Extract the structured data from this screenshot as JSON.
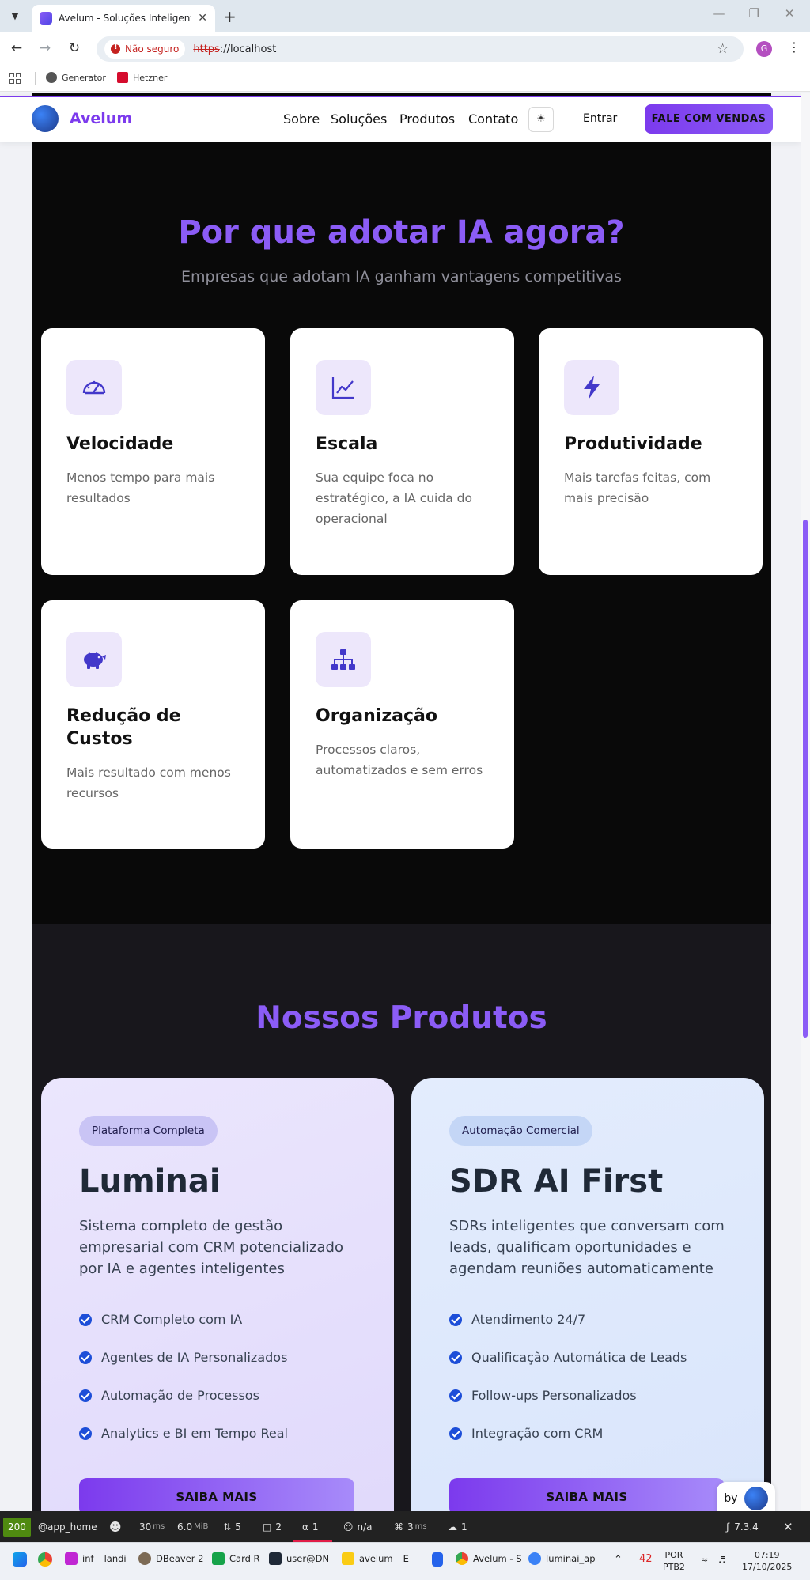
{
  "browser": {
    "tab_title": "Avelum - Soluções Inteligentes",
    "security_label": "Não seguro",
    "url_scheme": "https",
    "url_rest": "://localhost",
    "profile_initial": "G",
    "bookmarks": [
      "Generator",
      "Hetzner"
    ]
  },
  "header": {
    "logo_text": "Avelum",
    "logo_mark": "avelum",
    "nav": [
      "Sobre",
      "Soluções",
      "Produtos",
      "Contato"
    ],
    "login": "Entrar",
    "cta": "FALE COM VENDAS"
  },
  "why": {
    "title": "Por que adotar IA agora?",
    "subtitle": "Empresas que adotam IA ganham vantagens competitivas",
    "cards": [
      {
        "icon": "speedometer-icon",
        "title": "Velocidade",
        "desc": "Menos tempo para mais resultados"
      },
      {
        "icon": "chart-line-icon",
        "title": "Escala",
        "desc": "Sua equipe foca no estratégico, a IA cuida do operacional"
      },
      {
        "icon": "lightning-icon",
        "title": "Produtividade",
        "desc": "Mais tarefas feitas, com mais precisão"
      },
      {
        "icon": "piggy-bank-icon",
        "title": "Redução de Custos",
        "desc": "Mais resultado com menos recursos"
      },
      {
        "icon": "org-chart-icon",
        "title": "Organização",
        "desc": "Processos claros, automatizados e sem erros"
      }
    ]
  },
  "products": {
    "title": "Nossos Produtos",
    "items": [
      {
        "badge": "Plataforma Completa",
        "title": "Luminai",
        "desc": "Sistema completo de gestão empresarial com CRM potencializado por IA e agentes inteligentes",
        "features": [
          "CRM Completo com IA",
          "Agentes de IA Personalizados",
          "Automação de Processos",
          "Analytics e BI em Tempo Real"
        ],
        "button": "SAIBA MAIS"
      },
      {
        "badge": "Automação Comercial",
        "title": "SDR AI First",
        "desc": "SDRs inteligentes que conversam com leads, qualificam oportunidades e agendam reuniões automaticamente",
        "features": [
          "Atendimento 24/7",
          "Qualificação Automática de Leads",
          "Follow-ups Personalizados",
          "Integração com CRM"
        ],
        "button": "SAIBA MAIS"
      }
    ],
    "by_label": "by"
  },
  "debugbar": {
    "status": "200",
    "route": "@app_home",
    "time": "30",
    "time_unit": "ms",
    "memory": "6.0",
    "memory_unit": "MiB",
    "requests": "5",
    "forms": "2",
    "translations": "1",
    "user": "n/a",
    "twig": "3",
    "twig_unit": "ms",
    "uploads": "1",
    "version": "7.3.4"
  },
  "taskbar": {
    "apps": [
      "inf – landi",
      "DBeaver 2",
      "Card R",
      "user@DN",
      "avelum – E",
      "Avelum - S",
      "luminai_ap"
    ],
    "weather": "42",
    "lang_top": "POR",
    "lang_bottom": "PTB2",
    "time": "07:19",
    "date": "17/10/2025"
  },
  "colors": {
    "accent": "#8b5cf6",
    "brand_dark": "#7c3aed",
    "section_black": "#090909",
    "section_dark": "#18171c"
  }
}
